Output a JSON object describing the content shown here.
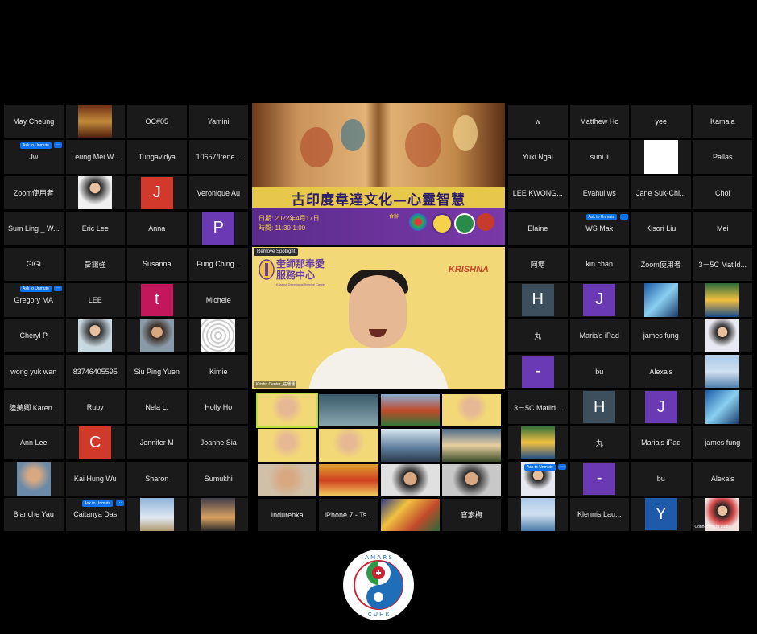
{
  "left_grid": [
    {
      "name": "May Cheung"
    },
    {
      "name": "",
      "photo": "temple-photo"
    },
    {
      "name": "OC#05"
    },
    {
      "name": "Yamini"
    },
    {
      "name": "Jw",
      "badge": "Ask to Unmute"
    },
    {
      "name": "Leung Mei W..."
    },
    {
      "name": "Tungavidya"
    },
    {
      "name": "10657/Irene..."
    },
    {
      "name": "Zoom使用者"
    },
    {
      "name": "",
      "photo": "woman-photo"
    },
    {
      "name": "",
      "avatar": "J",
      "color": "#d13a2a"
    },
    {
      "name": "Veronique Au"
    },
    {
      "name": "Sum Ling _ W..."
    },
    {
      "name": "Eric Lee"
    },
    {
      "name": "Anna"
    },
    {
      "name": "",
      "avatar": "P",
      "color": "#6a3ab5"
    },
    {
      "name": "GiGi"
    },
    {
      "name": "彭靄強"
    },
    {
      "name": "Susanna"
    },
    {
      "name": "Fung Ching..."
    },
    {
      "name": "Gregory MA",
      "badge": "Ask to Unmute"
    },
    {
      "name": "LEE"
    },
    {
      "name": "",
      "avatar": "t",
      "color": "#c2185b"
    },
    {
      "name": "Michele"
    },
    {
      "name": "Cheryl P"
    },
    {
      "name": "",
      "photo": "singer-photo"
    },
    {
      "name": "",
      "photo": "man-glasses-photo"
    },
    {
      "name": "",
      "photo": "flower-of-life-photo"
    },
    {
      "name": "wong yuk wan"
    },
    {
      "name": "83746405595"
    },
    {
      "name": "Siu Ping Yuen"
    },
    {
      "name": "Kimie"
    },
    {
      "name": "陸美卿 Karen..."
    },
    {
      "name": "Ruby"
    },
    {
      "name": "Nela L."
    },
    {
      "name": "Holly Ho"
    },
    {
      "name": "Ann Lee"
    },
    {
      "name": "",
      "avatar": "C",
      "color": "#d13a2a"
    },
    {
      "name": "Jennifer M"
    },
    {
      "name": "Joanne Sia"
    },
    {
      "name": "",
      "photo": "man-smile-photo"
    },
    {
      "name": "Kai Hung Wu"
    },
    {
      "name": "Sharon"
    },
    {
      "name": "Sumukhi"
    },
    {
      "name": "Blanche Yau"
    },
    {
      "name": "Caitanya Das",
      "badge": "Ask to Unmute"
    },
    {
      "name": "",
      "photo": "beach-photo"
    },
    {
      "name": "",
      "photo": "sunset-photo"
    }
  ],
  "right_grid": [
    {
      "name": "w"
    },
    {
      "name": "Matthew Ho"
    },
    {
      "name": "yee"
    },
    {
      "name": "Kamala"
    },
    {
      "name": "Yuki Ngai"
    },
    {
      "name": "suni li"
    },
    {
      "name": "",
      "photo": "white-photo"
    },
    {
      "name": "Pallas"
    },
    {
      "name": "LEE KWONG..."
    },
    {
      "name": "Evahui ws"
    },
    {
      "name": "Jane Suk-Chi..."
    },
    {
      "name": "Choi"
    },
    {
      "name": "Elaine"
    },
    {
      "name": "WS Mak",
      "badge": "Ask to Unmute"
    },
    {
      "name": "Kisori Liu"
    },
    {
      "name": "Mei"
    },
    {
      "name": "阿塘"
    },
    {
      "name": "kin chan"
    },
    {
      "name": "Zoom使用者"
    },
    {
      "name": "3－5C Matild..."
    },
    {
      "name": "",
      "avatar": "H",
      "color": "#3d4e5c"
    },
    {
      "name": "",
      "avatar": "J",
      "color": "#6a3ab5"
    },
    {
      "name": "",
      "photo": "wave-photo"
    },
    {
      "name": "",
      "photo": "room-photo"
    },
    {
      "name": "丸"
    },
    {
      "name": "Maria's iPad"
    },
    {
      "name": "james fung"
    },
    {
      "name": "",
      "photo": "girl-photo"
    },
    {
      "name": "",
      "avatar": "-",
      "color": "#6a3ab5"
    },
    {
      "name": "bu"
    },
    {
      "name": "Alexa's"
    },
    {
      "name": "",
      "photo": "lake-photo"
    },
    {
      "name": "3－5C Matild..."
    },
    {
      "name": "",
      "avatar": "H",
      "color": "#3d4e5c"
    },
    {
      "name": "",
      "avatar": "J",
      "color": "#6a3ab5"
    },
    {
      "name": "",
      "photo": "wave-photo"
    },
    {
      "name": "",
      "photo": "room-photo"
    },
    {
      "name": "丸"
    },
    {
      "name": "Maria's iPad"
    },
    {
      "name": "james fung"
    },
    {
      "name": "",
      "photo": "girl-photo",
      "badge": "Ask to Unmute"
    },
    {
      "name": "",
      "avatar": "-",
      "color": "#6a3ab5"
    },
    {
      "name": "bu"
    },
    {
      "name": "Alexa's"
    },
    {
      "name": "",
      "photo": "lake-photo"
    },
    {
      "name": "Klennis Lau..."
    },
    {
      "name": "",
      "avatar": "Y",
      "color": "#1e5aa8"
    },
    {
      "name": "",
      "photo": "woman-red-photo",
      "status": "Connecting to audio"
    }
  ],
  "slide": {
    "title": "古印度韋達文化—心靈智慧",
    "date_line": "日期: 2022年4月17日",
    "time_line": "時間: 11:30-1:00",
    "coop": "合辦"
  },
  "speaker": {
    "spotlight_label": "Remove Spotlight",
    "org_name_line1": "奎師那奉愛",
    "org_name_line2": "服務中心",
    "org_sub": "Krishna Devotional Service Center",
    "brand": "KRISHNA",
    "video_label": "Krishn Center_莊珊珊"
  },
  "thumbs": [
    {
      "name": "",
      "kind": "man"
    },
    {
      "name": "",
      "kind": "group"
    },
    {
      "name": "",
      "kind": "temple"
    },
    {
      "name": "",
      "kind": "woman"
    },
    {
      "name": "",
      "kind": "woman2"
    },
    {
      "name": "",
      "kind": "woman3"
    },
    {
      "name": "",
      "kind": "city"
    },
    {
      "name": "",
      "kind": "temple2"
    },
    {
      "name": "",
      "kind": "women"
    },
    {
      "name": "",
      "kind": "deity"
    },
    {
      "name": "",
      "kind": "woman4"
    },
    {
      "name": "",
      "kind": "woman5"
    },
    {
      "name": "Indurehka"
    },
    {
      "name": "iPhone 7 - Ts..."
    },
    {
      "name": "",
      "kind": "painting"
    },
    {
      "name": "官素梅"
    }
  ],
  "logo": {
    "letters": "A M A R S C U H K"
  }
}
